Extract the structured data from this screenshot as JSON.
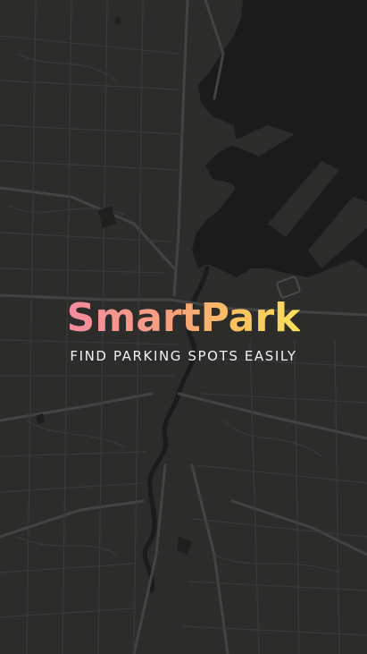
{
  "splash": {
    "app_name": "SmartPark",
    "tagline": "FIND PARKING SPOTS EASILY"
  },
  "map": {
    "style": "dark",
    "land_color": "#2c2c2b",
    "water_color": "#1b1b1b",
    "road_color": "#3a3a39",
    "major_road_color": "#434342"
  },
  "colors": {
    "title_gradient_start": "#f58ba0",
    "title_gradient_end": "#fbe05a",
    "tagline": "#f2f2f2"
  }
}
